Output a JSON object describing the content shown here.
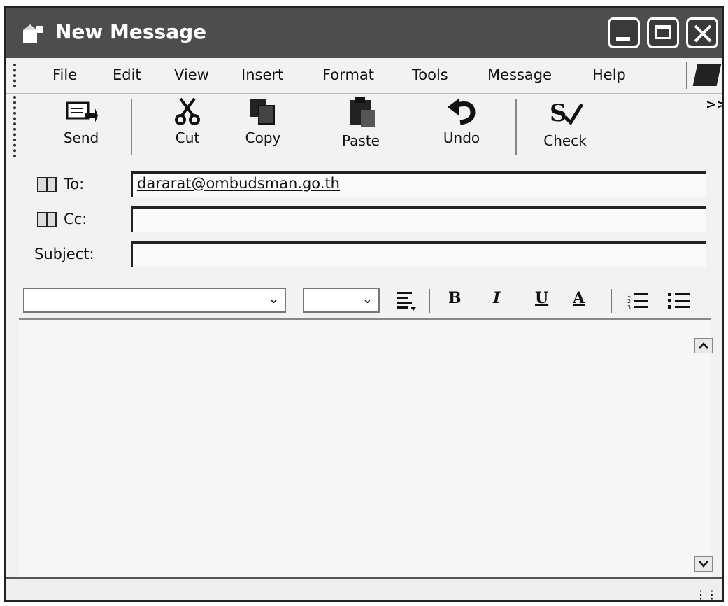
{
  "window": {
    "title": "New Message"
  },
  "menu": [
    "File",
    "Edit",
    "View",
    "Insert",
    "Format",
    "Tools",
    "Message",
    "Help"
  ],
  "toolbar": {
    "send": "Send",
    "cut": "Cut",
    "copy": "Copy",
    "paste": "Paste",
    "undo": "Undo",
    "check": "Check",
    "overflow": ">>"
  },
  "headers": {
    "to_label": "To:",
    "to_value": "dararat@ombudsman.go.th",
    "cc_label": "Cc:",
    "cc_value": "",
    "subject_label": "Subject:",
    "subject_value": ""
  },
  "format": {
    "font_value": "",
    "size_value": "",
    "bold": "B",
    "italic": "I",
    "underline": "U",
    "font_color": "A"
  },
  "icons": [
    "new-message-icon",
    "send-icon",
    "cut-icon",
    "copy-icon",
    "paste-icon",
    "undo-icon",
    "check-icon",
    "address-book-icon",
    "paragraph-style-icon",
    "numbered-list-icon",
    "bullet-list-icon",
    "scroll-up-icon",
    "scroll-down-icon",
    "windows-logo-icon"
  ]
}
